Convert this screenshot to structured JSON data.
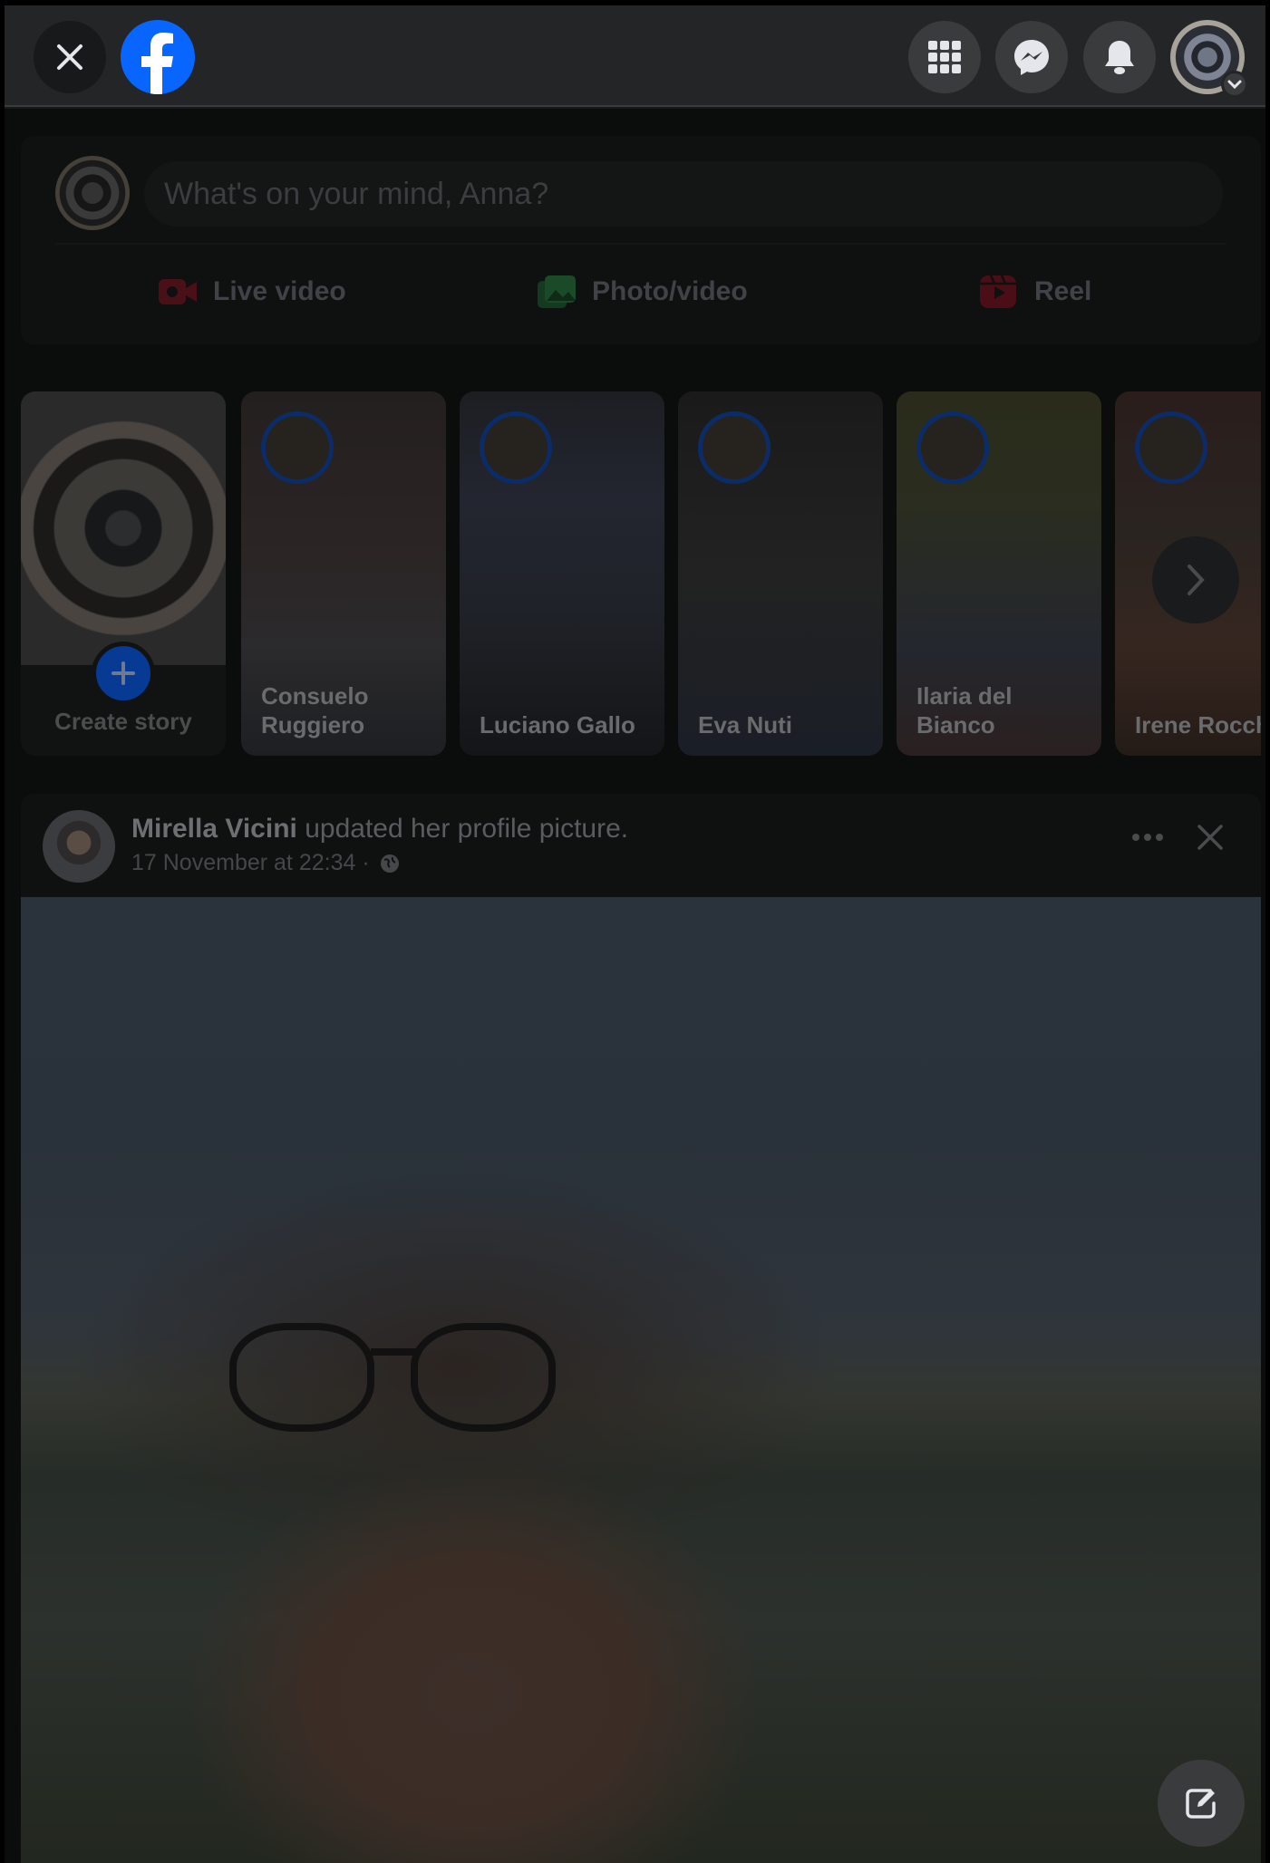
{
  "topbar": {
    "close_icon": "close-icon",
    "logo_icon": "facebook-logo",
    "menu_icon": "grid-menu-icon",
    "messenger_icon": "messenger-icon",
    "notifications_icon": "bell-icon",
    "account_icon": "avatar"
  },
  "composer": {
    "placeholder": "What's on your mind, Anna?",
    "actions": [
      {
        "label": "Live video",
        "icon": "live-video-icon",
        "color": "#f02849"
      },
      {
        "label": "Photo/video",
        "icon": "photo-icon",
        "color": "#45bd62"
      },
      {
        "label": "Reel",
        "icon": "reel-icon",
        "color": "#e42645"
      }
    ]
  },
  "stories": {
    "create_label": "Create story",
    "items": [
      {
        "name": "Consuelo Ruggiero"
      },
      {
        "name": "Luciano Gallo"
      },
      {
        "name": "Eva Nuti"
      },
      {
        "name": "Ilaria del Bianco"
      },
      {
        "name": "Irene Rocch"
      }
    ]
  },
  "post": {
    "author": "Mirella Vicini",
    "action": "updated her profile picture.",
    "timestamp": "17 November at 22:34 ·",
    "privacy_icon": "globe-icon"
  },
  "colors": {
    "accent": "#0866ff",
    "topbar_bg": "#242526",
    "button_bg": "#3a3b3c"
  }
}
